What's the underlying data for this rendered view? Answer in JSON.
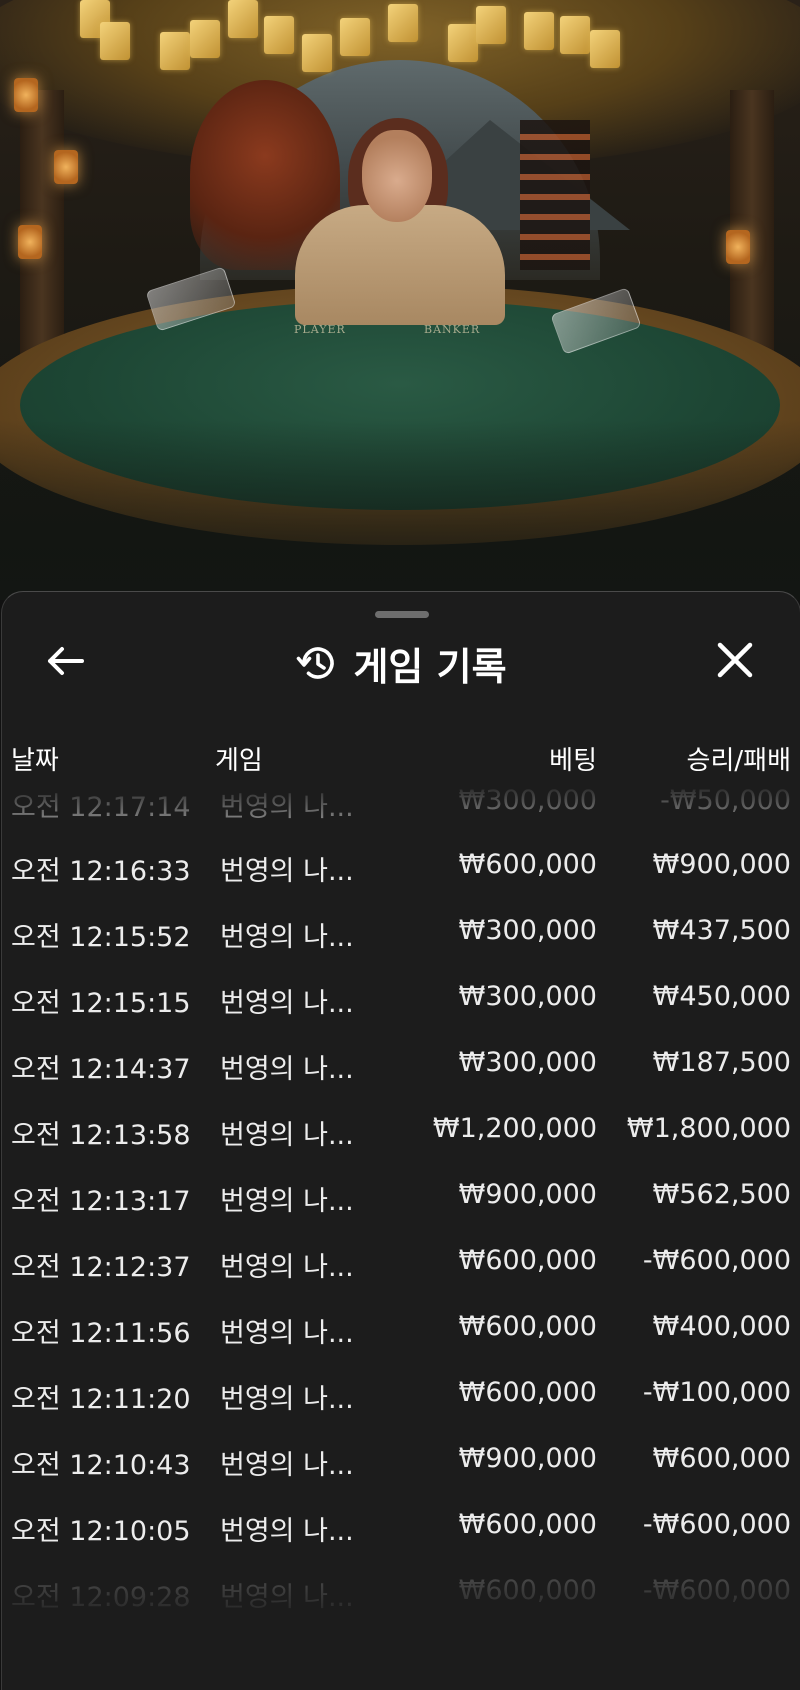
{
  "video": {
    "table_labels": [
      "PLAYER",
      "BANKER"
    ]
  },
  "panel": {
    "title": "게임 기록",
    "icons": {
      "back": "arrow-left-icon",
      "history": "history-icon",
      "close": "close-icon"
    },
    "columns": {
      "date": "날짜",
      "game": "게임",
      "bet": "베팅",
      "result": "승리/패배"
    },
    "rows": [
      {
        "date": "오전 12:17:14",
        "game": "번영의 나...",
        "bet": "₩300,000",
        "result": "-₩50,000"
      },
      {
        "date": "오전 12:16:33",
        "game": "번영의 나...",
        "bet": "₩600,000",
        "result": "₩900,000"
      },
      {
        "date": "오전 12:15:52",
        "game": "번영의 나...",
        "bet": "₩300,000",
        "result": "₩437,500"
      },
      {
        "date": "오전 12:15:15",
        "game": "번영의 나...",
        "bet": "₩300,000",
        "result": "₩450,000"
      },
      {
        "date": "오전 12:14:37",
        "game": "번영의 나...",
        "bet": "₩300,000",
        "result": "₩187,500"
      },
      {
        "date": "오전 12:13:58",
        "game": "번영의 나...",
        "bet": "₩1,200,000",
        "result": "₩1,800,000"
      },
      {
        "date": "오전 12:13:17",
        "game": "번영의 나...",
        "bet": "₩900,000",
        "result": "₩562,500"
      },
      {
        "date": "오전 12:12:37",
        "game": "번영의 나...",
        "bet": "₩600,000",
        "result": "-₩600,000"
      },
      {
        "date": "오전 12:11:56",
        "game": "번영의 나...",
        "bet": "₩600,000",
        "result": "₩400,000"
      },
      {
        "date": "오전 12:11:20",
        "game": "번영의 나...",
        "bet": "₩600,000",
        "result": "-₩100,000"
      },
      {
        "date": "오전 12:10:43",
        "game": "번영의 나...",
        "bet": "₩900,000",
        "result": "₩600,000"
      },
      {
        "date": "오전 12:10:05",
        "game": "번영의 나...",
        "bet": "₩600,000",
        "result": "-₩600,000"
      },
      {
        "date": "오전 12:09:28",
        "game": "번영의 나...",
        "bet": "₩600,000",
        "result": "-₩600,000"
      }
    ]
  },
  "colors": {
    "panel_bg": "#1c1c1c",
    "text": "#ececec",
    "header_text": "#ffffff",
    "felt": "#1d4634"
  }
}
